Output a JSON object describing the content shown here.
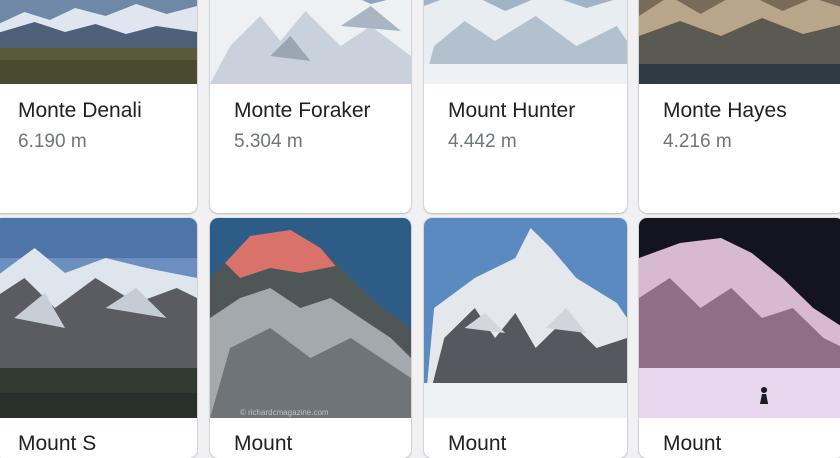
{
  "results": [
    {
      "name": "Monte Denali",
      "height": "6.190 m"
    },
    {
      "name": "Monte Foraker",
      "height": "5.304 m"
    },
    {
      "name": "Mount Hunter",
      "height": "4.442 m"
    },
    {
      "name": "Monte Hayes",
      "height": "4.216 m"
    },
    {
      "name": "Mount S",
      "height": ""
    },
    {
      "name": "Mount",
      "height": ""
    },
    {
      "name": "Mount",
      "height": ""
    },
    {
      "name": "Mount",
      "height": ""
    }
  ],
  "watermark": "© richardcmagazine.com",
  "colors": {
    "card_bg": "#ffffff",
    "title_text": "#202124",
    "subtitle_text": "#70757a",
    "page_bg": "#f1f1f3"
  }
}
